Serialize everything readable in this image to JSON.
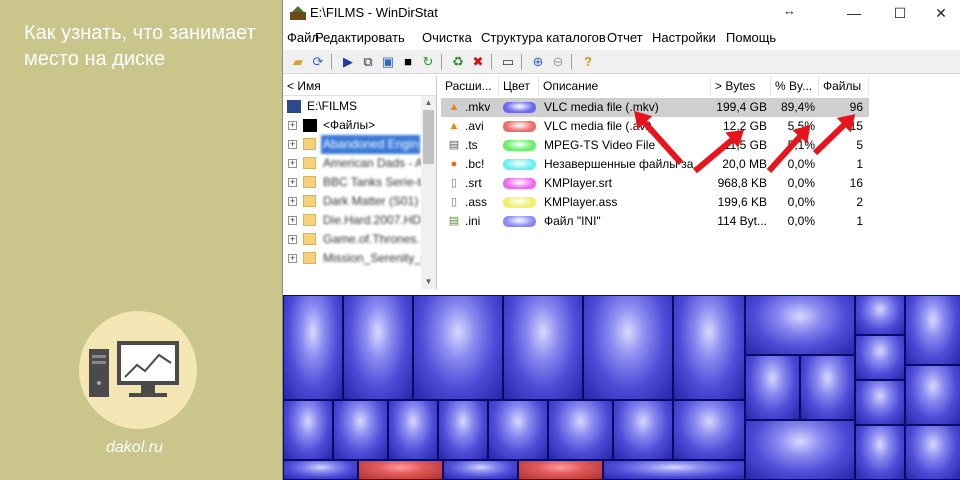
{
  "promo": {
    "title": "Как узнать, что занимает место на диске",
    "site": "dakol.ru"
  },
  "window": {
    "title": "E:\\FILMS - WinDirStat",
    "resize_glyph": "↔",
    "min": "—",
    "max": "☐",
    "close": "✕"
  },
  "menu": [
    "Файл",
    "Редактировать",
    "Очистка",
    "Структура каталогов",
    "Отчет",
    "Настройки",
    "Помощь"
  ],
  "tree": {
    "header": "< Имя",
    "root": "E:\\FILMS",
    "files": "<Файлы>",
    "items": [
      "Abandoned Engin",
      "American Dads - A",
      "BBC Tanks Serie-ta",
      "Dark Matter (S01)",
      "Die.Hard.2007.HDTVF",
      "Game.of.Thrones.",
      "Mission_Serenity_("
    ]
  },
  "ext": {
    "headers": [
      "Расши...",
      "Цвет",
      "Описание",
      "> Bytes",
      "% By...",
      "Файлы"
    ],
    "rows": [
      {
        "ext": ".mkv",
        "color": "#6a6af0",
        "desc": "VLC media file (.mkv)",
        "bytes": "199,4 GB",
        "pct": "89,4%",
        "files": "96",
        "icon": "vlc-icon"
      },
      {
        "ext": ".avi",
        "color": "#f06a6a",
        "desc": "VLC media file (.avi)",
        "bytes": "12,2 GB",
        "pct": "5,5%",
        "files": "15",
        "icon": "vlc-icon"
      },
      {
        "ext": ".ts",
        "color": "#6af06a",
        "desc": "MPEG-TS Video File",
        "bytes": "11,5 GB",
        "pct": "5,1%",
        "files": "5",
        "icon": "ts-file-icon"
      },
      {
        "ext": ".bc!",
        "color": "#6af0f0",
        "desc": "Незавершенные файлы за...",
        "bytes": "20,0 MB",
        "pct": "0,0%",
        "files": "1",
        "icon": "bittorrent-icon"
      },
      {
        "ext": ".srt",
        "color": "#f06af0",
        "desc": "KMPlayer.srt",
        "bytes": "968,8 KB",
        "pct": "0,0%",
        "files": "16",
        "icon": "srt-file-icon"
      },
      {
        "ext": ".ass",
        "color": "#f0f06a",
        "desc": "KMPlayer.ass",
        "bytes": "199,6 KB",
        "pct": "0,0%",
        "files": "2",
        "icon": "ass-file-icon"
      },
      {
        "ext": ".ini",
        "color": "#8a8af8",
        "desc": "Файл \"INI\"",
        "bytes": "114 Byt...",
        "pct": "0,0%",
        "files": "1",
        "icon": "ini-file-icon"
      }
    ]
  },
  "colors": {
    "accent_arrow": "#e8141c",
    "treemap_blue": "#4c4cd8",
    "treemap_red": "#e05a5a"
  }
}
